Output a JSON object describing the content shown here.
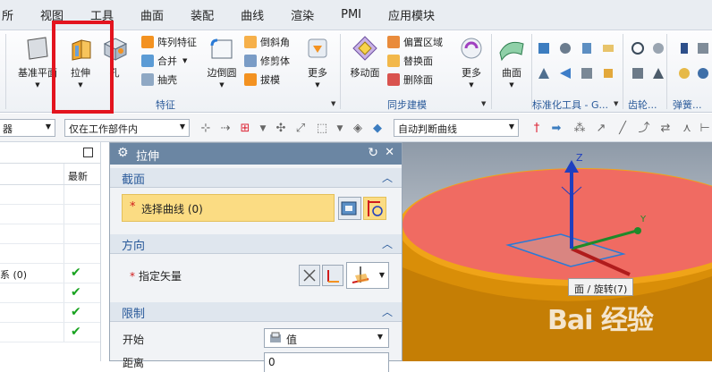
{
  "menubar": {
    "items": [
      "所",
      "视图",
      "工具",
      "曲面",
      "装配",
      "曲线",
      "渲染",
      "PMI",
      "应用模块"
    ]
  },
  "ribbon": {
    "base_plane_label": "基准平面",
    "extrude_label": "拉伸",
    "hole_label": "孔",
    "array_feature_label": "阵列特征",
    "unite_label": "合并",
    "shell_label": "抽壳",
    "edge_blend_label": "边倒圆",
    "chamfer_label": "倒斜角",
    "trim_body_label": "修剪体",
    "draft_label": "拔模",
    "more_label": "更多",
    "move_face_label": "移动面",
    "offset_region_label": "偏置区域",
    "replace_face_label": "替换面",
    "delete_face_label": "删除面",
    "more2_label": "更多",
    "surface_label": "曲面",
    "group_feature": "特征",
    "group_sync": "同步建模",
    "group_std_tools": "标准化工具 - G...",
    "group_gear": "齿轮...",
    "group_spring": "弹簧..."
  },
  "toolbar": {
    "filter_value": "器",
    "scope_value": "仅在工作部件内",
    "curve_rule_value": "自动判断曲线"
  },
  "navigator": {
    "newest_header": "最新",
    "rows": [
      {
        "text": ""
      },
      {
        "text": ""
      },
      {
        "text": ""
      },
      {
        "text": ""
      },
      {
        "text": "系 (0)",
        "checked": true
      },
      {
        "text": "",
        "checked": true
      },
      {
        "text": "",
        "checked": true
      },
      {
        "text": "",
        "checked": true
      }
    ]
  },
  "dialog": {
    "title": "拉伸",
    "section_title": "截面",
    "select_curve_label": "选择曲线 (0)",
    "direction_title": "方向",
    "specify_vector_label": "指定矢量",
    "limits_title": "限制",
    "start_label": "开始",
    "start_value": "值",
    "distance_label": "距离",
    "distance_value": "0"
  },
  "viewport": {
    "axis_z": "Z",
    "axis_y": "Y",
    "tooltip": "面 / 旋转(7)",
    "watermark": "Bai 经验"
  }
}
